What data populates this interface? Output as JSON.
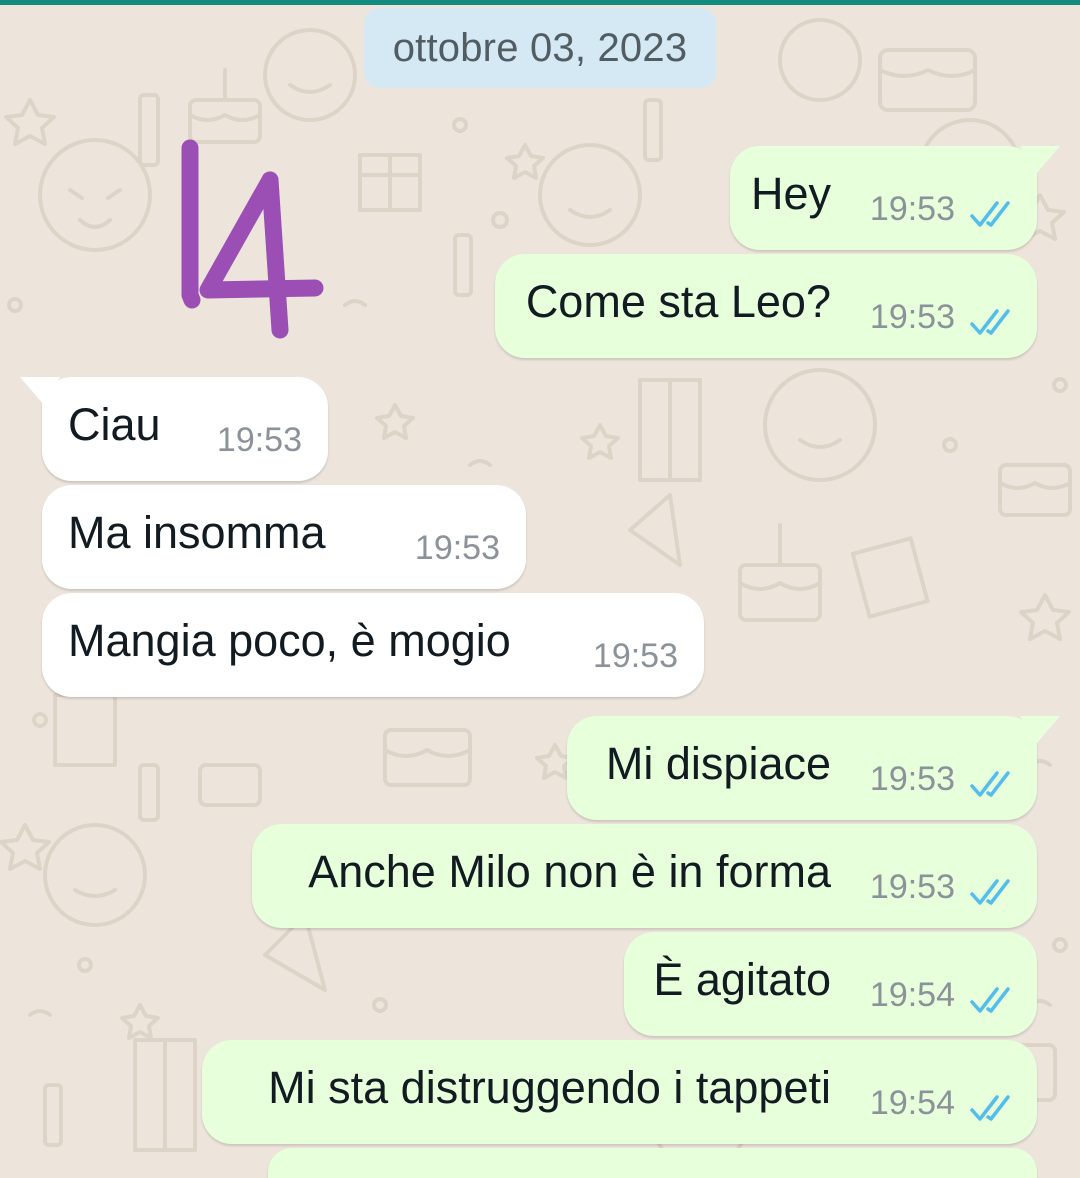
{
  "chat": {
    "date_separator": "ottobre 03, 2023",
    "annotation": "14",
    "messages": [
      {
        "text": "Hey",
        "time": "19:53",
        "direction": "outgoing",
        "status": "read"
      },
      {
        "text": "Come sta Leo?",
        "time": "19:53",
        "direction": "outgoing",
        "status": "read"
      },
      {
        "text": "Ciau",
        "time": "19:53",
        "direction": "incoming"
      },
      {
        "text": "Ma insomma",
        "time": "19:53",
        "direction": "incoming"
      },
      {
        "text": "Mangia poco, è mogio",
        "time": "19:53",
        "direction": "incoming"
      },
      {
        "text": "Mi dispiace",
        "time": "19:53",
        "direction": "outgoing",
        "status": "read"
      },
      {
        "text": "Anche Milo non è in forma",
        "time": "19:53",
        "direction": "outgoing",
        "status": "read"
      },
      {
        "text": "È agitato",
        "time": "19:54",
        "direction": "outgoing",
        "status": "read"
      },
      {
        "text": "Mi sta distruggendo i tappeti",
        "time": "19:54",
        "direction": "outgoing",
        "status": "read"
      }
    ]
  },
  "colors": {
    "outgoing_bubble": "#e7ffdb",
    "incoming_bubble": "#ffffff",
    "wallpaper": "#ede5dc",
    "read_ticks": "#53bdeb",
    "date_chip": "#d4e9f4",
    "annotation_ink": "#9b4fb4"
  },
  "icons": {
    "read_receipt": "double-check-icon",
    "wallpaper": "party-doodle-pattern"
  }
}
